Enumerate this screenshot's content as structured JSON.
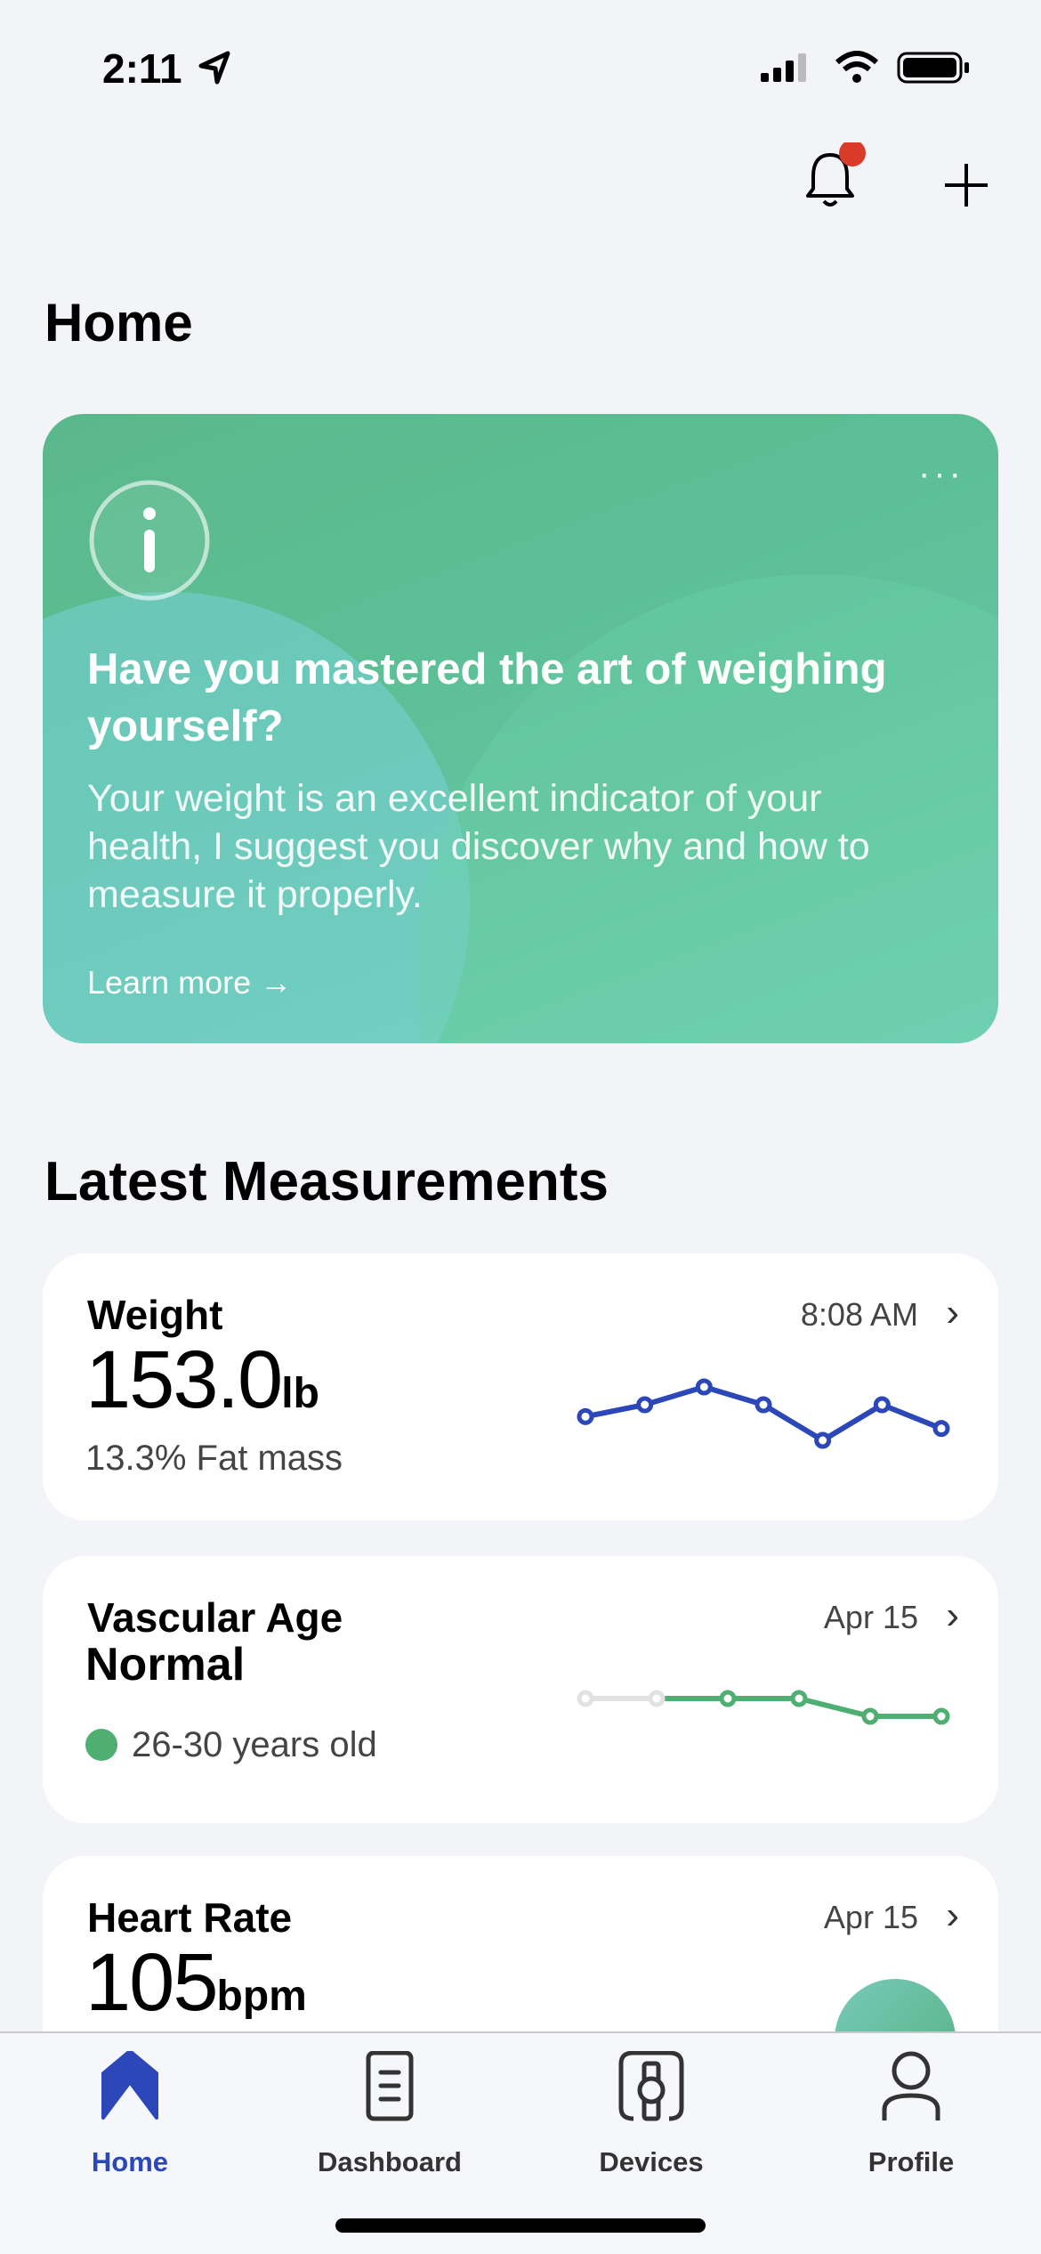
{
  "status_bar": {
    "time": "2:11"
  },
  "header": {
    "title": "Home",
    "notification_dot_color": "#d93b2b"
  },
  "promo": {
    "title": "Have you mastered the art of weighing yourself?",
    "body": "Your weight is an excellent indicator of your health, I suggest you discover why and how to measure it properly.",
    "link": "Learn more →",
    "more": "···"
  },
  "section_title": "Latest Measurements",
  "measurements": [
    {
      "title": "Weight",
      "time": "8:08 AM",
      "value": "153.0",
      "unit": "lb",
      "detail": "13.3% Fat mass",
      "trend": [
        153.3,
        153.5,
        153.8,
        153.5,
        152.9,
        153.5,
        153.1
      ],
      "color": "#2b47b8"
    },
    {
      "title": "Vascular Age",
      "time": "Apr 15",
      "value": "Normal",
      "detail": "26-30 years old",
      "status_color": "#4fae72",
      "trend": [
        1,
        1,
        1,
        1,
        0.8,
        0.8
      ],
      "trend_inactive_points": 2,
      "color": "#4fae72"
    },
    {
      "title": "Heart Rate",
      "time": "Apr 15",
      "value": "105",
      "unit": "bpm"
    }
  ],
  "tabs": [
    {
      "label": "Home",
      "active": true
    },
    {
      "label": "Dashboard"
    },
    {
      "label": "Devices"
    },
    {
      "label": "Profile"
    }
  ],
  "accent": "#2b47b8"
}
